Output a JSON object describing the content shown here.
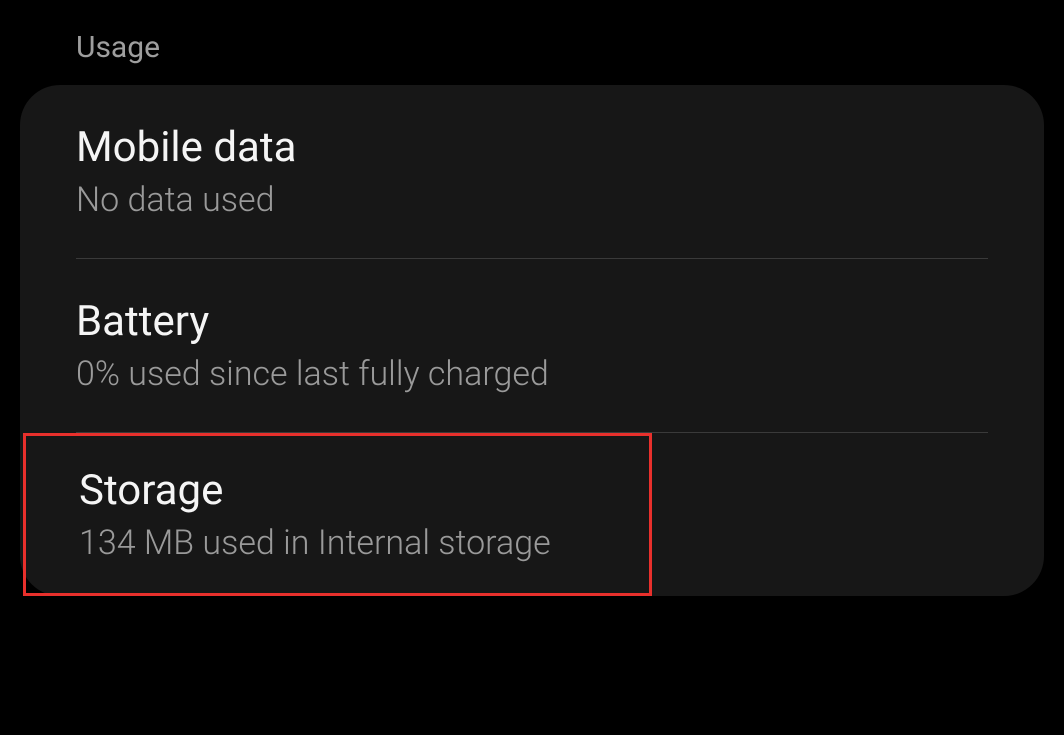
{
  "section": {
    "title": "Usage"
  },
  "items": {
    "mobile_data": {
      "title": "Mobile data",
      "subtitle": "No data used"
    },
    "battery": {
      "title": "Battery",
      "subtitle": "0% used since last fully charged"
    },
    "storage": {
      "title": "Storage",
      "subtitle": "134 MB used in Internal storage"
    }
  }
}
